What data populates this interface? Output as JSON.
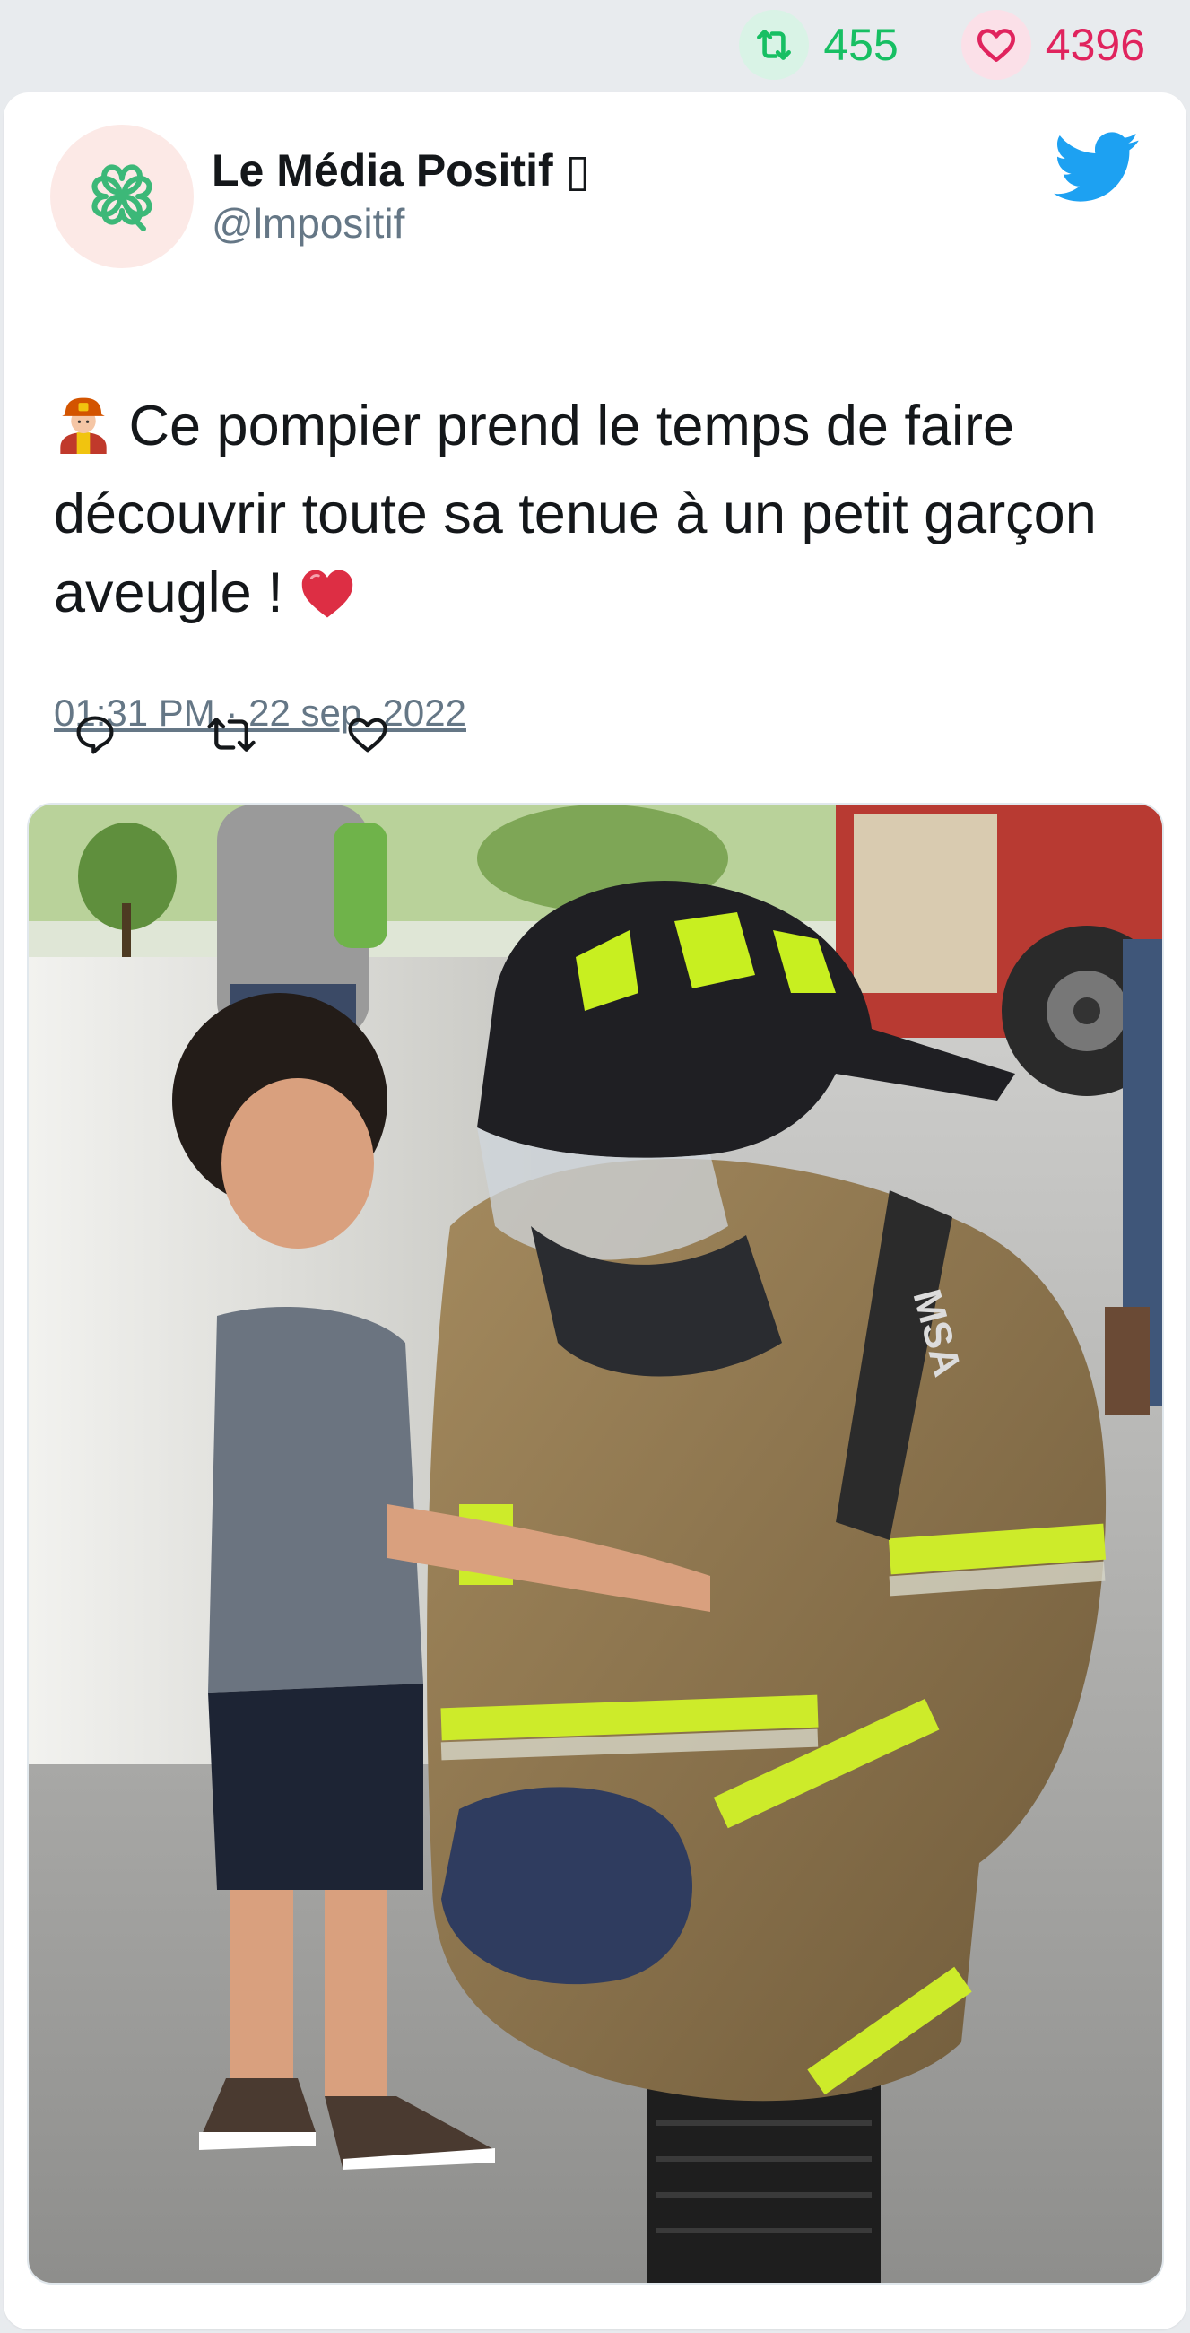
{
  "stats": {
    "retweet_count": "455",
    "like_count": "4396",
    "retweet_color": "#17bf63",
    "like_color": "#e0245e"
  },
  "tweet": {
    "author_name": "Le Média Positif ▯",
    "author_handle": "@lmpositif",
    "avatar_icon": "four-leaf-clover-icon",
    "brand_icon": "twitter-bird-icon",
    "emoji_start": "firefighter-emoji",
    "text": "Ce pompier prend le temps de faire découvrir toute sa tenue à un petit garçon aveugle !",
    "emoji_end": "red-heart-emoji",
    "timestamp": "01:31 PM · 22 sep. 2022",
    "actions": [
      "reply-icon",
      "retweet-icon",
      "like-icon"
    ],
    "accent_color": "#1da1f2"
  }
}
